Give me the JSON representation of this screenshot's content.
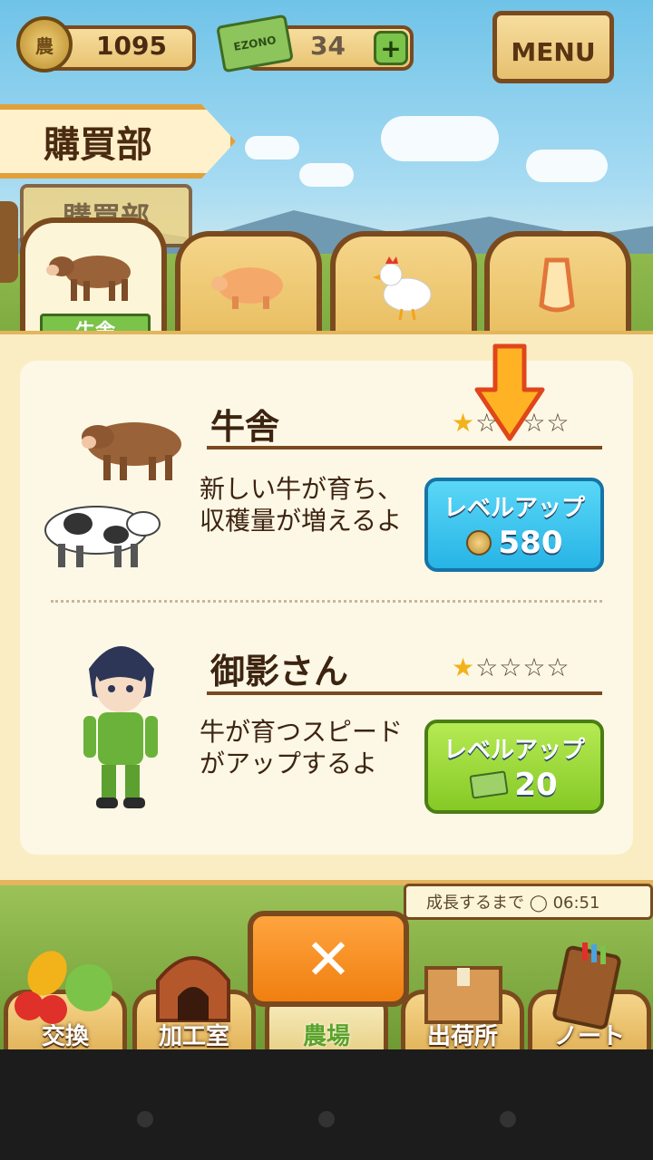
{
  "hud": {
    "coin_badge": "農",
    "coins": "1095",
    "ticket_label": "EZONO",
    "tickets": "34",
    "add_label": "+",
    "menu_label": "MENU"
  },
  "screen": {
    "title": "購買部",
    "behind_title": "購買部"
  },
  "tabs": [
    {
      "icon": "cow-icon",
      "label": "牛舎",
      "active": true
    },
    {
      "icon": "pig-icon",
      "active": false
    },
    {
      "icon": "chicken-icon",
      "active": false
    },
    {
      "icon": "bell-icon",
      "active": false
    }
  ],
  "items": [
    {
      "title": "牛舎",
      "stars_filled": 1,
      "stars_total": 5,
      "description": "新しい牛が育ち、収穫量が増えるよ",
      "button_label": "レベルアップ",
      "cost": "580",
      "currency": "coin",
      "button_color": "#27b4e6"
    },
    {
      "title": "御影さん",
      "stars_filled": 1,
      "stars_total": 5,
      "description": "牛が育つスピードがアップするよ",
      "button_label": "レベルアップ",
      "cost": "20",
      "currency": "ticket",
      "button_color": "#86c926"
    }
  ],
  "timer_text": "成長するまで ◯ 06:51",
  "close_label": "✕",
  "nav": [
    {
      "icon": "vegetables-icon",
      "label": "交換"
    },
    {
      "icon": "oven-icon",
      "label": "加工室"
    },
    {
      "icon": "farm-icon",
      "label": "農場"
    },
    {
      "icon": "crate-icon",
      "label": "出荷所"
    },
    {
      "icon": "notebook-icon",
      "label": "ノート"
    }
  ]
}
